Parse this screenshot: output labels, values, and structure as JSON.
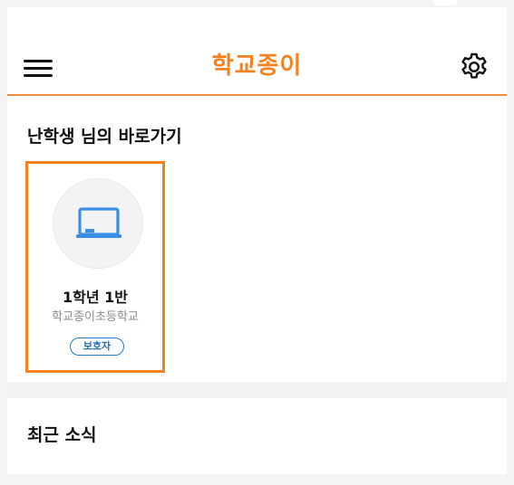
{
  "header": {
    "app_title": "학교종이",
    "menu_icon": "hamburger-menu-icon",
    "settings_icon": "gear-icon",
    "accent_color": "#f58220"
  },
  "shortcuts": {
    "heading": "난학생 님의 바로가기",
    "cards": [
      {
        "icon": "laptop-icon",
        "class_name": "1학년 1반",
        "school_name": "학교종이초등학교",
        "role": "보호자"
      }
    ]
  },
  "news": {
    "heading": "최근 소식"
  }
}
